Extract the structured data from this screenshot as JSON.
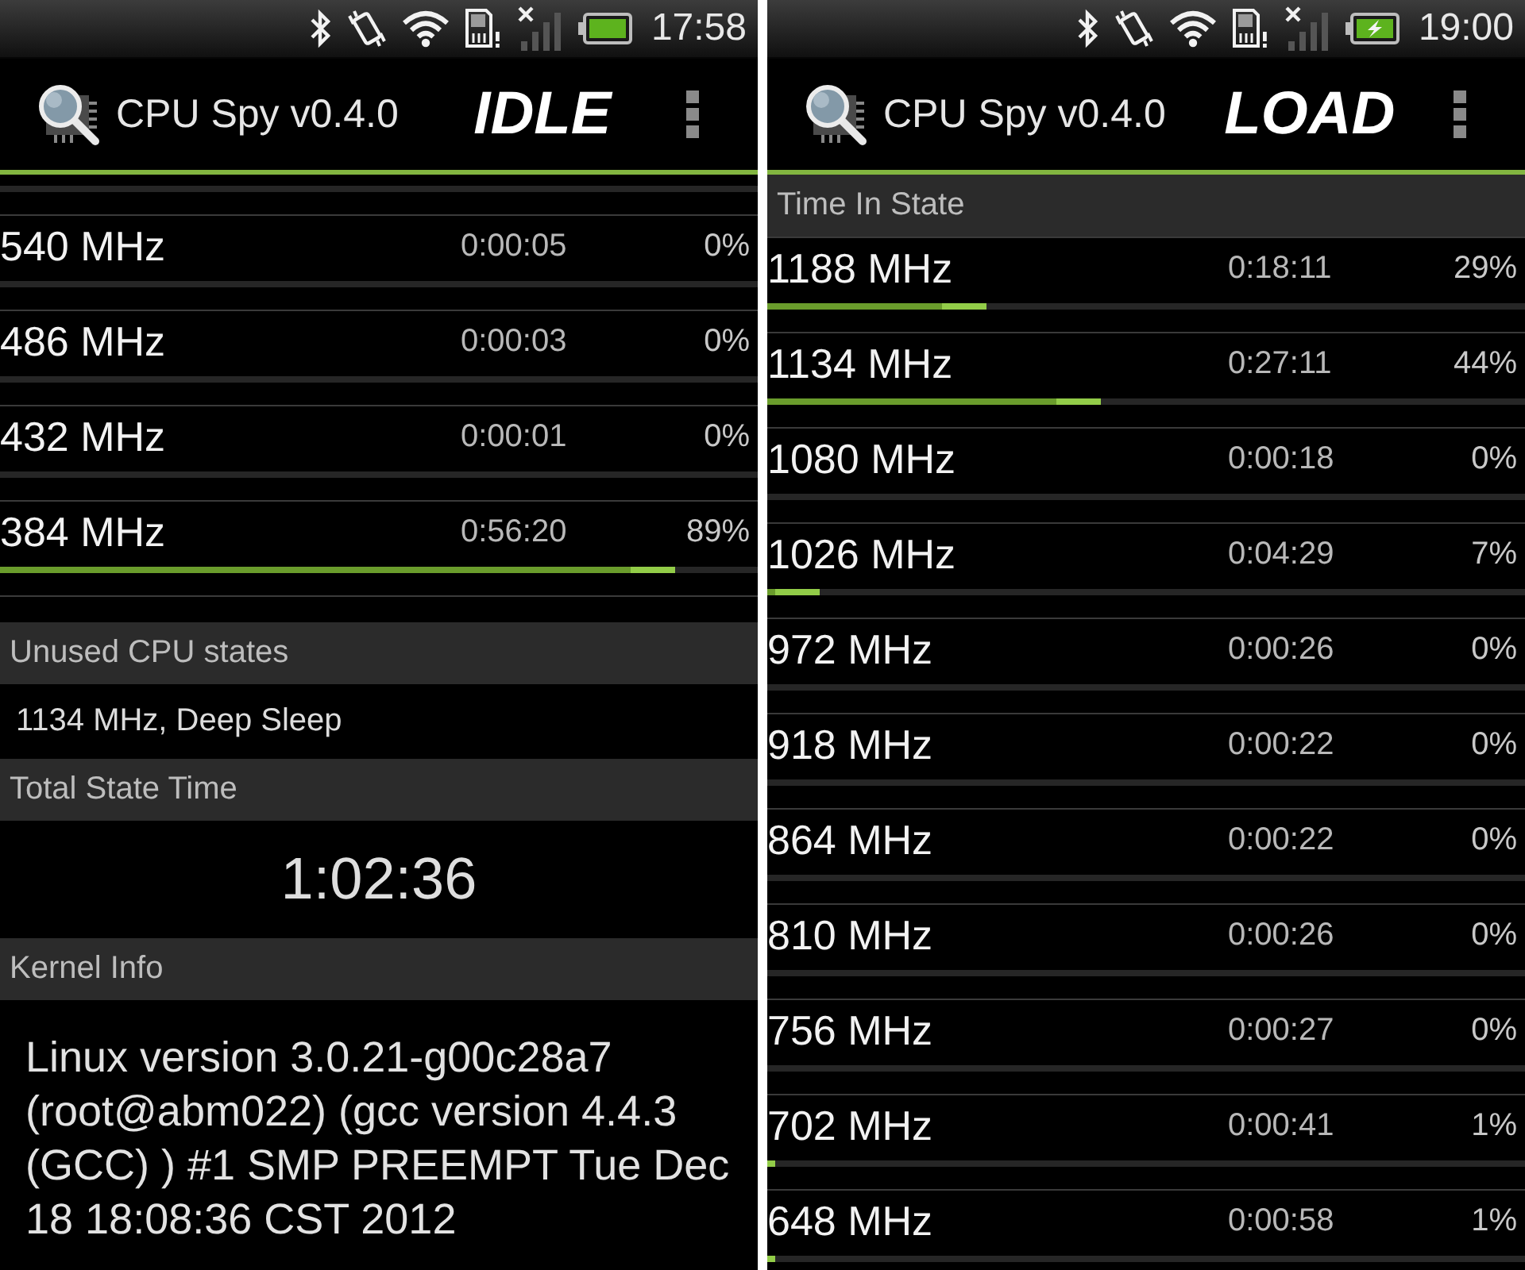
{
  "panels": [
    {
      "status_bar": {
        "time": "17:58",
        "charging": false
      },
      "action_bar": {
        "title": "CPU Spy v0.4.0",
        "mode_label": "IDLE"
      },
      "blocks": [
        {
          "kind": "clipped_row"
        },
        {
          "kind": "state_list",
          "rows": [
            {
              "frequency": "540 MHz",
              "time": "0:00:05",
              "percent": "0%"
            },
            {
              "frequency": "486 MHz",
              "time": "0:00:03",
              "percent": "0%"
            },
            {
              "frequency": "432 MHz",
              "time": "0:00:01",
              "percent": "0%"
            },
            {
              "frequency": "384 MHz",
              "time": "0:56:20",
              "percent": "89%",
              "level": 0.89
            }
          ]
        },
        {
          "kind": "header",
          "text": "Unused CPU states"
        },
        {
          "kind": "note",
          "text": "1134 MHz, Deep Sleep"
        },
        {
          "kind": "header",
          "text": "Total State Time"
        },
        {
          "kind": "total",
          "text": "1:02:36"
        },
        {
          "kind": "header",
          "text": "Kernel Info"
        },
        {
          "kind": "paragraph",
          "text": "Linux version 3.0.21-g00c28a7 (root@abm022) (gcc version 4.4.3 (GCC) ) #1 SMP PREEMPT Tue Dec 18 18:08:36 CST 2012"
        }
      ]
    },
    {
      "status_bar": {
        "time": "19:00",
        "charging": true
      },
      "action_bar": {
        "title": "CPU Spy v0.4.0",
        "mode_label": "LOAD"
      },
      "blocks": [
        {
          "kind": "header",
          "text": "Time In State"
        },
        {
          "kind": "state_list",
          "rows": [
            {
              "frequency": "1188 MHz",
              "time": "0:18:11",
              "percent": "29%",
              "level": 0.29
            },
            {
              "frequency": "1134 MHz",
              "time": "0:27:11",
              "percent": "44%",
              "level": 0.44
            },
            {
              "frequency": "1080 MHz",
              "time": "0:00:18",
              "percent": "0%"
            },
            {
              "frequency": "1026 MHz",
              "time": "0:04:29",
              "percent": "7%",
              "level": 0.07
            },
            {
              "frequency": "972 MHz",
              "time": "0:00:26",
              "percent": "0%"
            },
            {
              "frequency": "918 MHz",
              "time": "0:00:22",
              "percent": "0%"
            },
            {
              "frequency": "864 MHz",
              "time": "0:00:22",
              "percent": "0%"
            },
            {
              "frequency": "810 MHz",
              "time": "0:00:26",
              "percent": "0%"
            },
            {
              "frequency": "756 MHz",
              "time": "0:00:27",
              "percent": "0%"
            },
            {
              "frequency": "702 MHz",
              "time": "0:00:41",
              "percent": "1%",
              "level": 0.01
            },
            {
              "frequency": "648 MHz",
              "time": "0:00:58",
              "percent": "1%",
              "level": 0.01
            }
          ]
        }
      ]
    }
  ]
}
